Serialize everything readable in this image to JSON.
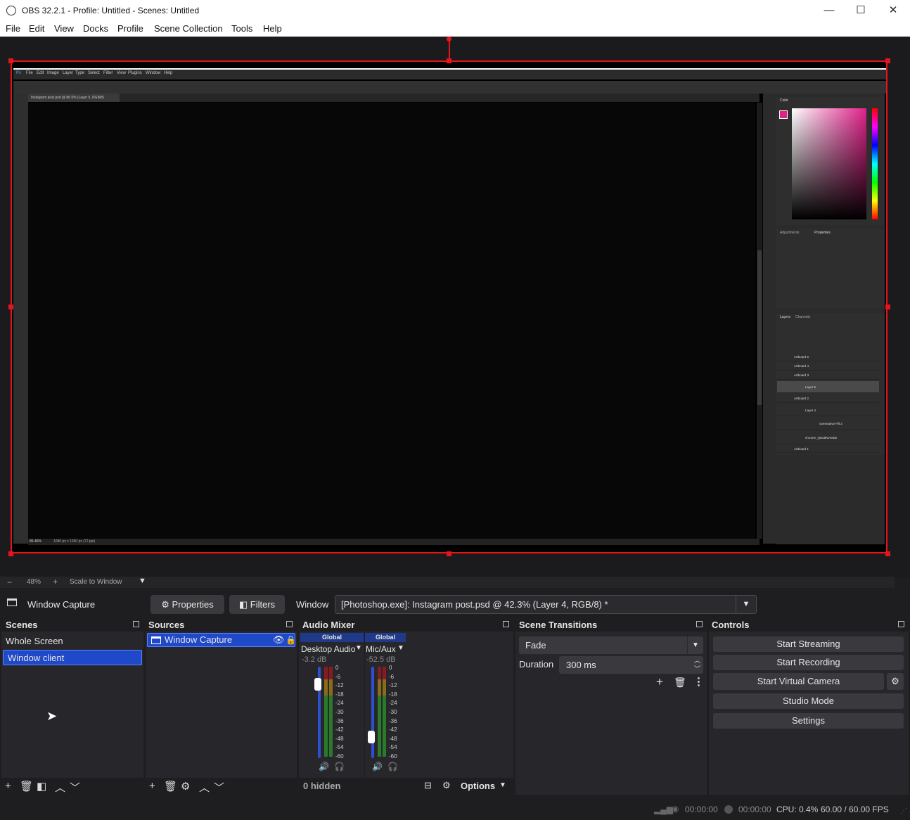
{
  "window": {
    "title": "OBS 32.2.1 - Profile: Untitled - Scenes: Untitled",
    "minimize": "—",
    "maximize": "☐",
    "close": "✕"
  },
  "menu": [
    "File",
    "Edit",
    "View",
    "Docks",
    "Profile",
    "Scene Collection",
    "Tools",
    "Help"
  ],
  "preview": {
    "zoom_minus": "−",
    "zoom_value": "48%",
    "zoom_plus": "+",
    "scale_mode": "Scale to Window",
    "captured_app": {
      "menu": [
        "File",
        "Edit",
        "Image",
        "Layer",
        "Type",
        "Select",
        "Filter",
        "View",
        "Plugins",
        "Window",
        "Help"
      ],
      "doc_tab": "Instagram post.psd @ 86.5% (Layer 5, RGB/8)",
      "status_zoom": "86.46%",
      "status_size": "1080 px x 1350 px (72 ppi)",
      "layers": [
        "Artboard 5",
        "Artboard 4",
        "Artboard 3",
        "Layer 5",
        "Artboard 2",
        "Layer 4",
        "Generative Fill 2",
        "chrome_Q5U8NvreBD",
        "Artboard 1"
      ],
      "panel_tabs": {
        "color": "Color",
        "adjustments": "Adjustments",
        "properties": "Properties",
        "layers": "Layers",
        "channels": "Channels"
      }
    }
  },
  "source_toolbar": {
    "source_name": "Window Capture",
    "properties_label": "Properties",
    "filters_label": "Filters",
    "window_label": "Window",
    "window_value": "[Photoshop.exe]: Instagram post.psd @ 42.3% (Layer 4, RGB/8) *"
  },
  "scenes": {
    "title": "Scenes",
    "items": [
      "Whole Screen",
      "Window client"
    ],
    "selected": 1
  },
  "sources": {
    "title": "Sources",
    "items": [
      "Window Capture"
    ]
  },
  "audio_mixer": {
    "title": "Audio Mixer",
    "channels": [
      {
        "badge": "Global",
        "name": "Desktop Audio",
        "db": "-3.2 dB",
        "fader_level": 0.85
      },
      {
        "badge": "Global",
        "name": "Mic/Aux",
        "db": "-52.5 dB",
        "fader_level": 0.25
      }
    ],
    "scale": [
      "0",
      "-6",
      "-12",
      "-18",
      "-24",
      "-30",
      "-36",
      "-42",
      "-48",
      "-54",
      "-60"
    ],
    "hidden_label": "0 hidden",
    "options_label": "Options"
  },
  "scene_transitions": {
    "title": "Scene Transitions",
    "transition": "Fade",
    "duration_label": "Duration",
    "duration_value": "300 ms"
  },
  "controls": {
    "title": "Controls",
    "start_streaming": "Start Streaming",
    "start_recording": "Start Recording",
    "start_virtual_camera": "Start Virtual Camera",
    "studio_mode": "Studio Mode",
    "settings": "Settings"
  },
  "status": {
    "stream_time": "00:00:00",
    "record_time": "00:00:00",
    "cpu": "CPU: 0.4%",
    "fps": "60.00 / 60.00 FPS"
  },
  "colors": {
    "accent": "#2049c9",
    "selection_red": "#e8141c",
    "background": "#1e1e21",
    "dock": "#27272b"
  }
}
